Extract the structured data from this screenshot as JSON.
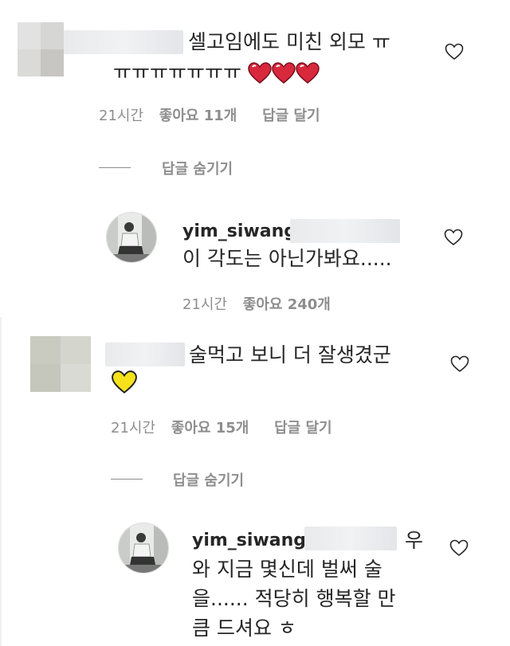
{
  "comment1": {
    "text_line1": "셀고임에도 미친 외모 ㅠ",
    "text_line2": "ㅠㅠㅠㅠㅠㅠㅠ",
    "emoji": [
      "heart-red",
      "heart-red",
      "heart-red"
    ],
    "time": "21시간",
    "likes": "좋아요 11개",
    "reply": "답글 달기",
    "hide_replies": "답글 숨기기"
  },
  "reply1": {
    "username": "yim_siwang",
    "text": "이 각도는 아닌가봐요.....",
    "time": "21시간",
    "likes": "좋아요 240개"
  },
  "comment2": {
    "text_line1": "술먹고 보니 더 잘생겼군",
    "emoji": [
      "heart-yellow"
    ],
    "time": "21시간",
    "likes": "좋아요 15개",
    "reply": "답글 달기",
    "hide_replies": "답글 숨기기"
  },
  "reply2": {
    "username": "yim_siwang",
    "text_tail": "우",
    "text_line2": "와 지금 몇신데 벌써 술",
    "text_line3": "을...... 적당히 행복할 만",
    "text_line4": "큼 드셔요 ㅎ"
  }
}
